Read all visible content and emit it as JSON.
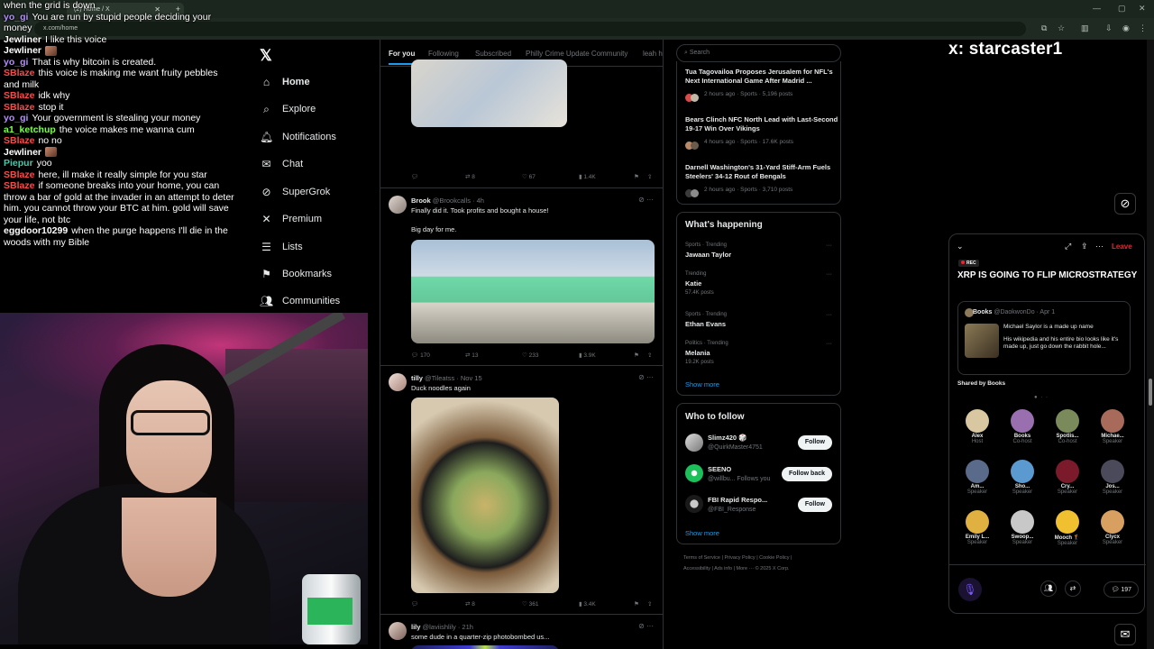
{
  "browser": {
    "tab_title": "(2) Home / X",
    "url": "x.com/home"
  },
  "chat": [
    {
      "user": "",
      "text": "when the grid is down",
      "color": "#ffffff"
    },
    {
      "user": "yo_gi",
      "text": "You are run by stupid people deciding your money",
      "color": "#b58cff"
    },
    {
      "user": "Jewliner",
      "text": "I like this voice",
      "color": "#ffffff"
    },
    {
      "user": "Jewliner",
      "text": "",
      "color": "#ffffff",
      "emote": true
    },
    {
      "user": "yo_gi",
      "text": "That is why bitcoin is created.",
      "color": "#b58cff"
    },
    {
      "user": "SBlaze",
      "text": "this voice is making me want fruity pebbles and milk",
      "color": "#ff4a4a"
    },
    {
      "user": "SBlaze",
      "text": "idk why",
      "color": "#ff4a4a"
    },
    {
      "user": "SBlaze",
      "text": "stop it",
      "color": "#ff4a4a"
    },
    {
      "user": "yo_gi",
      "text": "Your government is stealing your money",
      "color": "#b58cff"
    },
    {
      "user": "a1_ketchup",
      "text": "the voice makes me wanna cum",
      "color": "#7cff4a"
    },
    {
      "user": "SBlaze",
      "text": "no no",
      "color": "#ff4a4a"
    },
    {
      "user": "Jewliner",
      "text": "",
      "color": "#ffffff",
      "emote": true
    },
    {
      "user": "Piepur",
      "text": "yoo",
      "color": "#4ac8a8"
    },
    {
      "user": "SBlaze",
      "text": "here, ill make it really simple for you star",
      "color": "#ff4a4a"
    },
    {
      "user": "SBlaze",
      "text": "if someone breaks into your home, you can throw a bar of gold at the invader in an attempt to deter him. you cannot throw your BTC at him. gold will save your life, not btc",
      "color": "#ff4a4a"
    },
    {
      "user": "eggdoor10299",
      "text": "when the purge happens I'll die in the woods with my Bible",
      "color": "#ffffff"
    }
  ],
  "nav": {
    "home": "Home",
    "explore": "Explore",
    "notifications": "Notifications",
    "chat": "Chat",
    "supergrok": "SuperGrok",
    "premium": "Premium",
    "lists": "Lists",
    "bookmarks": "Bookmarks",
    "communities": "Communities"
  },
  "feed_tabs": [
    "For you",
    "Following",
    "Subscribed",
    "Philly Crime Update Community",
    "leah h"
  ],
  "posts": [
    {
      "actions": {
        "reply": "",
        "repost": "8",
        "like": "67",
        "views": "1.4K"
      }
    },
    {
      "name": "Brook",
      "handle": "@Brookcalls · 4h",
      "text1": "Finally did it. Took profits and bought a house!",
      "text2": "Big day for me.",
      "actions": {
        "reply": "170",
        "repost": "13",
        "like": "233",
        "views": "3.9K"
      }
    },
    {
      "name": "tilly",
      "handle": "@Tileatss · Nov 15",
      "text1": "Duck noodles again",
      "actions": {
        "reply": "",
        "repost": "8",
        "like": "361",
        "views": "3.4K"
      }
    },
    {
      "name": "lily",
      "handle": "@laviishlily · 21h",
      "text1": "some dude in a quarter-zip photobombed us..."
    }
  ],
  "search": {
    "placeholder": "Search"
  },
  "news": [
    {
      "title": "Tua Tagovailoa Proposes Jerusalem for NFL's Next International Game After Madrid ...",
      "meta": "2 hours ago · Sports · 5,196 posts"
    },
    {
      "title": "Bears Clinch NFC North Lead with Last-Second 19-17 Win Over Vikings",
      "meta": "4 hours ago · Sports · 17.6K posts"
    },
    {
      "title": "Darnell Washington's 31-Yard Stiff-Arm Fuels Steelers' 34-12 Rout of Bengals",
      "meta": "2 hours ago · Sports · 3,710 posts"
    }
  ],
  "happening": {
    "title": "What's happening",
    "trends": [
      {
        "context": "Sports · Trending",
        "name": "Jawaan Taylor",
        "count": ""
      },
      {
        "context": "Trending",
        "name": "Katie",
        "count": "57.4K posts"
      },
      {
        "context": "Sports · Trending",
        "name": "Ethan Evans",
        "count": ""
      },
      {
        "context": "Politics · Trending",
        "name": "Melania",
        "count": "19.2K posts"
      }
    ],
    "show_more": "Show more"
  },
  "who_to_follow": {
    "title": "Who to follow",
    "accounts": [
      {
        "name": "Slimz420 🎲",
        "handle": "@QuirkMaster4751",
        "button": "Follow"
      },
      {
        "name": "SEENO",
        "handle": "@willbu...  Follows you",
        "button": "Follow back"
      },
      {
        "name": "FBI Rapid Respo...",
        "handle": "@FBI_Response",
        "button": "Follow"
      }
    ],
    "show_more": "Show more"
  },
  "footer": {
    "line1": "Terms of Service   |   Privacy Policy   |   Cookie Policy   |",
    "line2": "Accessibility   |   Ads info   |   More ···   © 2025 X Corp."
  },
  "brand": "x: starcaster1",
  "space": {
    "leave": "Leave",
    "rec": "REC",
    "title": "XRP IS GOING TO FLIP MICROSTRATEGY",
    "pinned": {
      "author": "Books",
      "meta": "@DaokwonDo · Apr 1",
      "text1": "Michael Saylor is a made up name",
      "text2": "His wikipedia and his entire bio looks like it's made up, just go down the rabbit hole..."
    },
    "shared_by": "Shared by Books",
    "speakers": [
      {
        "name": "Alex",
        "role": "Host"
      },
      {
        "name": "Books",
        "role": "Co-host"
      },
      {
        "name": "Spotlis...",
        "role": "Co-host"
      },
      {
        "name": "Michae...",
        "role": "Speaker"
      },
      {
        "name": "Am...",
        "role": "Speaker"
      },
      {
        "name": "Sho...",
        "role": "Speaker"
      },
      {
        "name": "Cry...",
        "role": "Speaker"
      },
      {
        "name": "Jos...",
        "role": "Speaker"
      },
      {
        "name": "Emily L...",
        "role": "Speaker"
      },
      {
        "name": "Swoop...",
        "role": "Speaker"
      },
      {
        "name": "Mooch 🏌️",
        "role": "Speaker"
      },
      {
        "name": "Clycx",
        "role": "Speaker"
      }
    ],
    "listeners": "197"
  }
}
